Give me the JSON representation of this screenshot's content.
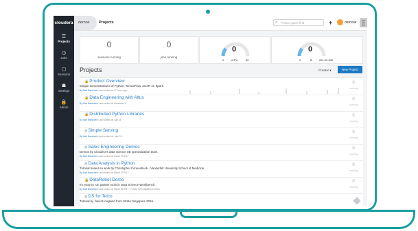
{
  "header": {
    "logo": "cloudera",
    "crumb_demos": "demos",
    "crumb_projects": "Projects",
    "search_placeholder": "Project quick find",
    "add_label": "+",
    "user_label": "demos▾"
  },
  "sidebar": {
    "items": [
      {
        "label": "Projects",
        "icon": "☰"
      },
      {
        "label": "Jobs",
        "icon": "◷"
      },
      {
        "label": "Sessions",
        "icon": "▢"
      },
      {
        "label": "Settings",
        "icon": "☗"
      },
      {
        "label": "Admin",
        "icon": "🔒"
      }
    ]
  },
  "stats": {
    "sessions_value": "0",
    "sessions_label": "sessions running",
    "jobs_value": "0",
    "jobs_label": "jobs running",
    "vcpu_value": "0",
    "vcpu_min": "0",
    "vcpu_label": "vCPU",
    "vcpu_max": "80",
    "mem_value": "0",
    "mem_min": "0",
    "mem_label": "B",
    "mem_max": "251.53 GiB"
  },
  "projects_header": {
    "title": "Projects",
    "sort_label": "Creator ▾",
    "new_project_label": "New Project"
  },
  "projects": [
    {
      "name": "Product Overview",
      "desc": "Simple demonstrations of Python, TensorFlow, and R on Spark.",
      "meta_by": "By Matt Brandwein",
      "meta_rest": " Last worked on 17 hours ago",
      "count": "0",
      "status": "running"
    },
    {
      "name": "Data Engineering with Altus",
      "desc": "",
      "meta_by": "By Matt Brandwein",
      "meta_rest": " Last worked on November 6",
      "count": "0",
      "status": "running"
    },
    {
      "name": "Distributed Python Libraries",
      "desc": "",
      "meta_by": "By Matt Brandwein",
      "meta_rest": " Last worked on July 18",
      "count": "0",
      "status": "running"
    },
    {
      "name": "Simple Serving",
      "desc": "",
      "meta_by": "By Matt Brandwein",
      "meta_rest": " Last worked on June 19",
      "count": "0",
      "status": "running"
    },
    {
      "name": "Sales Engineering Demos",
      "desc": "Demos by Cloudera's data science SE specialization team.",
      "meta_by": "By Matt Brandwein",
      "meta_rest": " Last worked on March 29 2017",
      "count": "0",
      "status": "running"
    },
    {
      "name": "Data Analysis in Python",
      "desc": "Tutorial based on work by Christopher Fonnesbeck - Vanderbilt University School of Medicine.",
      "meta_by": "By Matt Brandwein",
      "meta_rest": " Last worked on March 29 2017",
      "count": "0",
      "status": "running"
    },
    {
      "name": "DataRobot Demo",
      "desc": "It's easy to run partner tools in Data Science Workbench.",
      "meta_by": "By Matt Brandwein",
      "meta_rest": " Last worked on March 29 2017 · Forked from DataRobot Demo",
      "count": "0",
      "status": "running"
    },
    {
      "name": "DS for Telco",
      "desc": "Tutorial by Juliet Hougland from Strata Singapore 2016.",
      "meta_by": "",
      "meta_rest": "",
      "count": "",
      "status": ""
    }
  ],
  "colors": {
    "accent": "#1a9ea1",
    "link": "#2a7fc9",
    "button": "#1b79c3",
    "sidebar": "#22262e"
  }
}
